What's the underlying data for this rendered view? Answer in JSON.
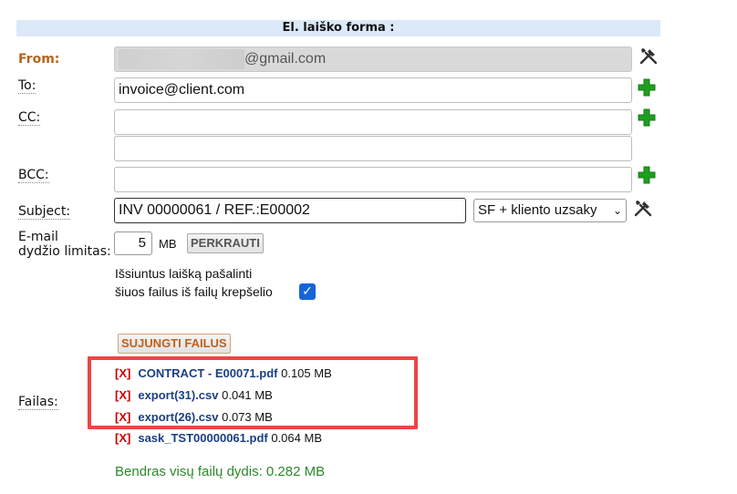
{
  "form": {
    "title": "El. laiško forma :"
  },
  "labels": {
    "from": "From:",
    "to": "To:",
    "cc": "CC:",
    "bcc": "BCC:",
    "subject": "Subject:",
    "email_limit_line1": "E-mail",
    "email_limit_line2": "dydžio limitas:",
    "files": "Failas:"
  },
  "fields": {
    "from_suffix": "@gmail.com",
    "to_value": "invoice@client.com",
    "cc_value": "",
    "cc2_value": "",
    "bcc_value": "",
    "subject_value": "INV 00000061 / REF.:E00002",
    "template_select": "SF + kliento uzsaky",
    "limit_value": "5",
    "limit_unit": "MB"
  },
  "buttons": {
    "reload": "PERKRAUTI",
    "merge": "SUJUNGTI FAILUS"
  },
  "checkbox": {
    "line1": "Išsiuntus laišką pašalinti",
    "line2": "šiuos failus iš failų krepšelio",
    "checked": true
  },
  "files": [
    {
      "remove": "[X]",
      "name": "CONTRACT - E00071.pdf",
      "size": "0.105 MB"
    },
    {
      "remove": "[X]",
      "name": "export(31).csv",
      "size": "0.041 MB"
    },
    {
      "remove": "[X]",
      "name": "export(26).csv",
      "size": "0.073 MB"
    },
    {
      "remove": "[X]",
      "name": "sask_TST00000061.pdf",
      "size": "0.064 MB"
    }
  ],
  "total": "Bendras visų failų dydis: 0.282 MB",
  "colors": {
    "plus": "#1e9e1e",
    "highlight": "#ef4444",
    "title_bg": "#dbe9f8"
  }
}
